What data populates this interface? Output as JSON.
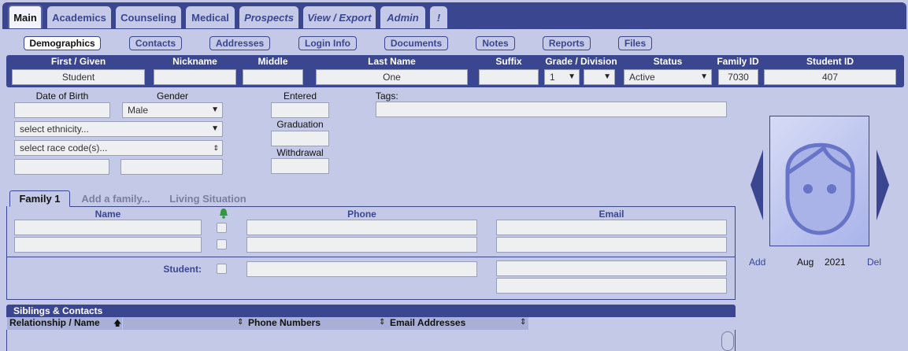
{
  "top_tabs": [
    {
      "label": "Main",
      "active": true
    },
    {
      "label": "Academics"
    },
    {
      "label": "Counseling"
    },
    {
      "label": "Medical"
    },
    {
      "label": "Prospects"
    },
    {
      "label": "View / Export"
    },
    {
      "label": "Admin"
    },
    {
      "label": "!"
    }
  ],
  "sub_tabs": [
    "Demographics",
    "Contacts",
    "Addresses",
    "Login Info",
    "Documents",
    "Notes",
    "Reports",
    "Files"
  ],
  "name_band": {
    "first_label": "First / Given",
    "first_value": "Student",
    "nickname_label": "Nickname",
    "nickname_value": "",
    "middle_label": "Middle",
    "middle_value": "",
    "last_label": "Last Name",
    "last_value": "One",
    "suffix_label": "Suffix",
    "suffix_value": "",
    "grade_label": "Grade / Division",
    "grade_value": "1",
    "division_value": "",
    "status_label": "Status",
    "status_value": "Active",
    "family_id_label": "Family ID",
    "family_id_value": "7030",
    "student_id_label": "Student ID",
    "student_id_value": "407"
  },
  "demographics": {
    "dob_label": "Date of Birth",
    "dob_value": "",
    "gender_label": "Gender",
    "gender_value": "Male",
    "ethnicity_value": "select ethnicity...",
    "race_value": "select race code(s)...",
    "extra1_value": "",
    "extra2_value": "",
    "entered_label": "Entered",
    "entered_value": "",
    "graduation_label": "Graduation",
    "graduation_value": "",
    "withdrawal_label": "Withdrawal",
    "withdrawal_value": "",
    "tags_label": "Tags:",
    "tags_value": ""
  },
  "family": {
    "tabs": [
      {
        "label": "Family 1",
        "active": true
      },
      {
        "label": "Add a family..."
      },
      {
        "label": "Living Situation"
      }
    ],
    "name_header": "Name",
    "phone_header": "Phone",
    "email_header": "Email",
    "notify_icon": "bell-icon",
    "student_label": "Student:"
  },
  "photo": {
    "add_label": "Add",
    "month": "Aug",
    "year": "2021",
    "del_label": "Del",
    "placeholder_icon": "avatar-placeholder-icon"
  },
  "siblings": {
    "title": "Siblings & Contacts",
    "columns": [
      "Relationship / Name",
      "",
      "Phone Numbers",
      "Email Addresses"
    ],
    "sort_icon": "sort-arrows-icon"
  },
  "colors": {
    "brand": "#3b4691",
    "background": "#c3c9e6",
    "field": "#eeeff1",
    "bell": "#2e9a3a"
  }
}
